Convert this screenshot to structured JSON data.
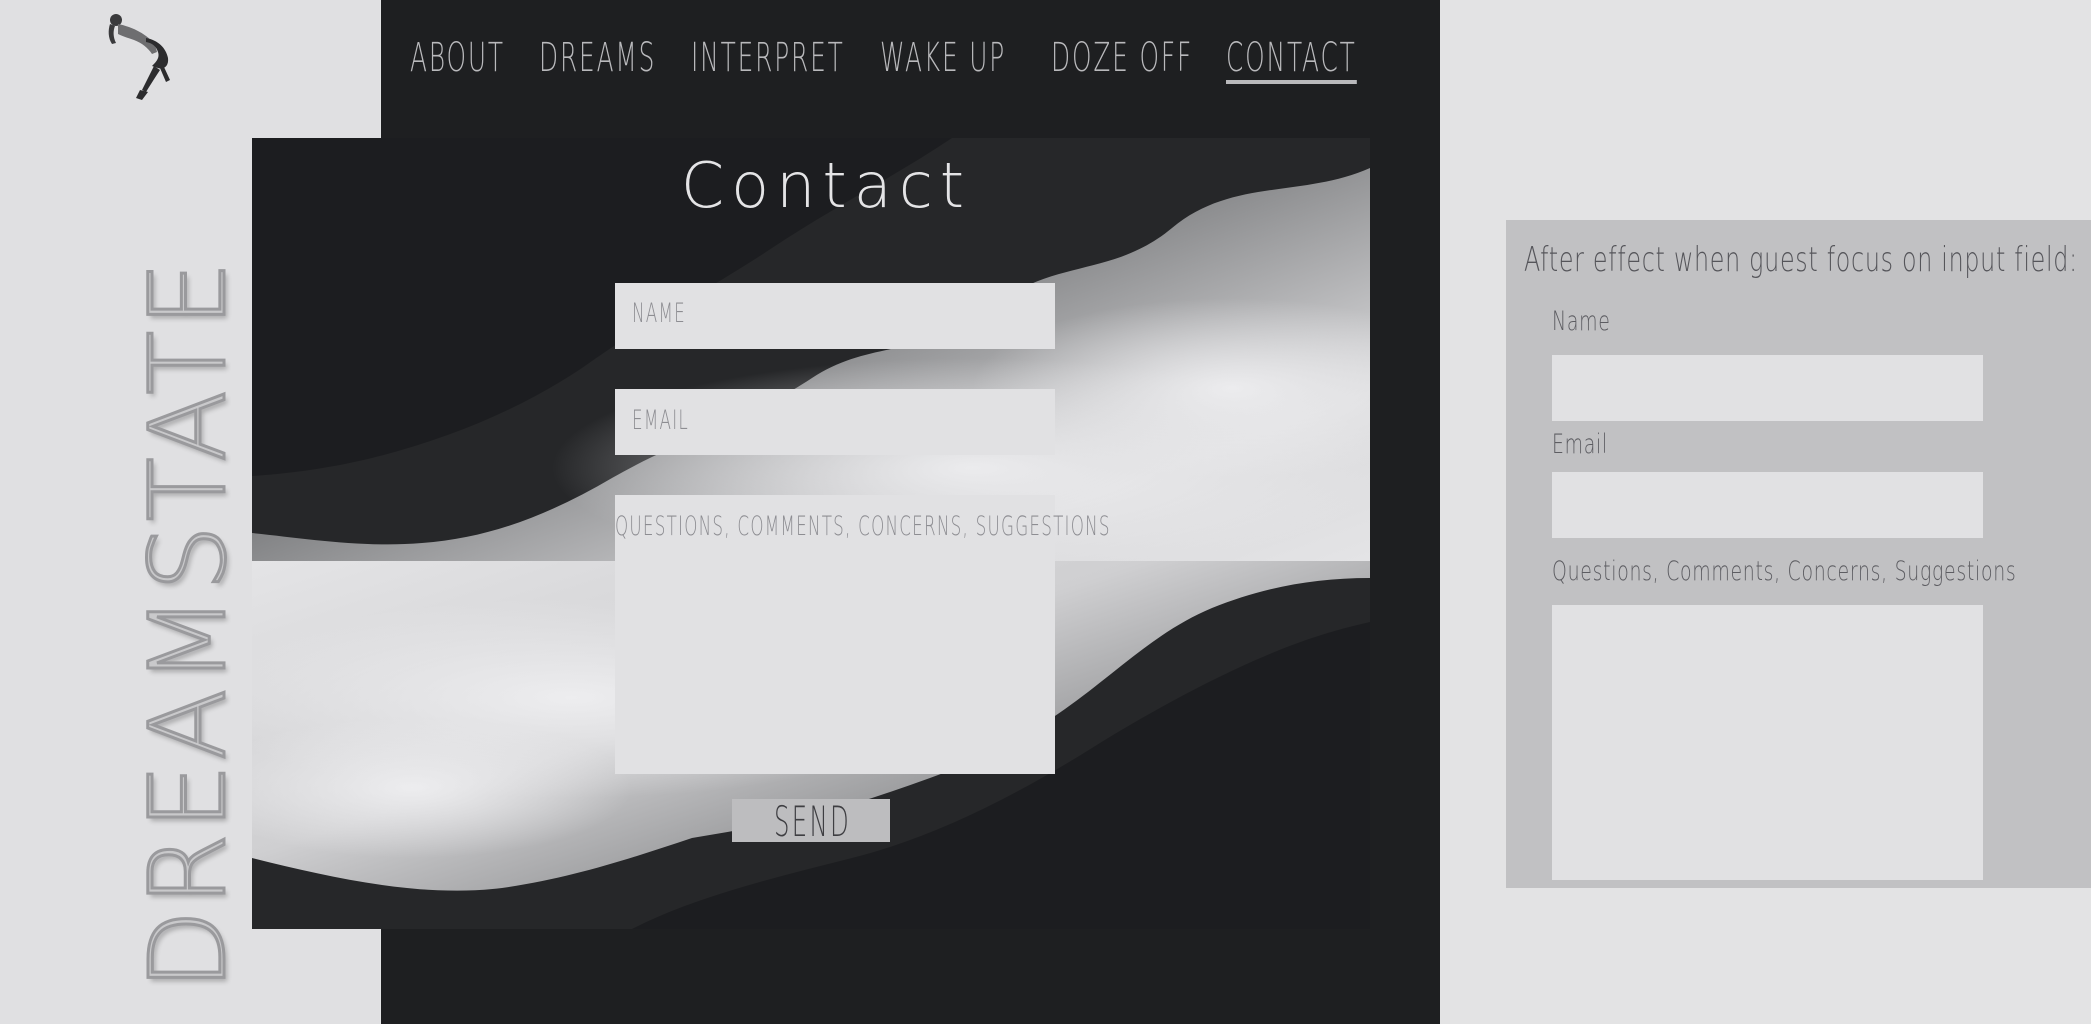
{
  "brand": {
    "wordmark": "DREAMSTATE",
    "figure_icon": "dreamer-figure-icon"
  },
  "nav": {
    "items": [
      {
        "label": "ABOUT",
        "active": false
      },
      {
        "label": "DREAMS",
        "active": false
      },
      {
        "label": "INTERPRET",
        "active": false
      },
      {
        "label": "WAKE UP",
        "active": false
      },
      {
        "label": "DOZE OFF",
        "active": false
      },
      {
        "label": "CONTACT",
        "active": true
      }
    ]
  },
  "contact": {
    "title": "Contact",
    "name_placeholder": "NAME",
    "email_placeholder": "EMAIL",
    "message_placeholder": "QUESTIONS, COMMENTS, CONCERNS, SUGGESTIONS",
    "send_label": "SEND"
  },
  "after_effect": {
    "title": "After effect when guest focus on input field:",
    "name_label": "Name",
    "email_label": "Email",
    "message_label": "Questions, Comments, Concerns, Suggestions"
  },
  "colors": {
    "page_background": "#e3e3e4",
    "panel_dark": "#1e1f21",
    "nav_text": "#b9b9bc",
    "field_background": "#e1e1e3",
    "send_background": "#bdbdbf",
    "annotation_panel": "#c1c1c3"
  }
}
